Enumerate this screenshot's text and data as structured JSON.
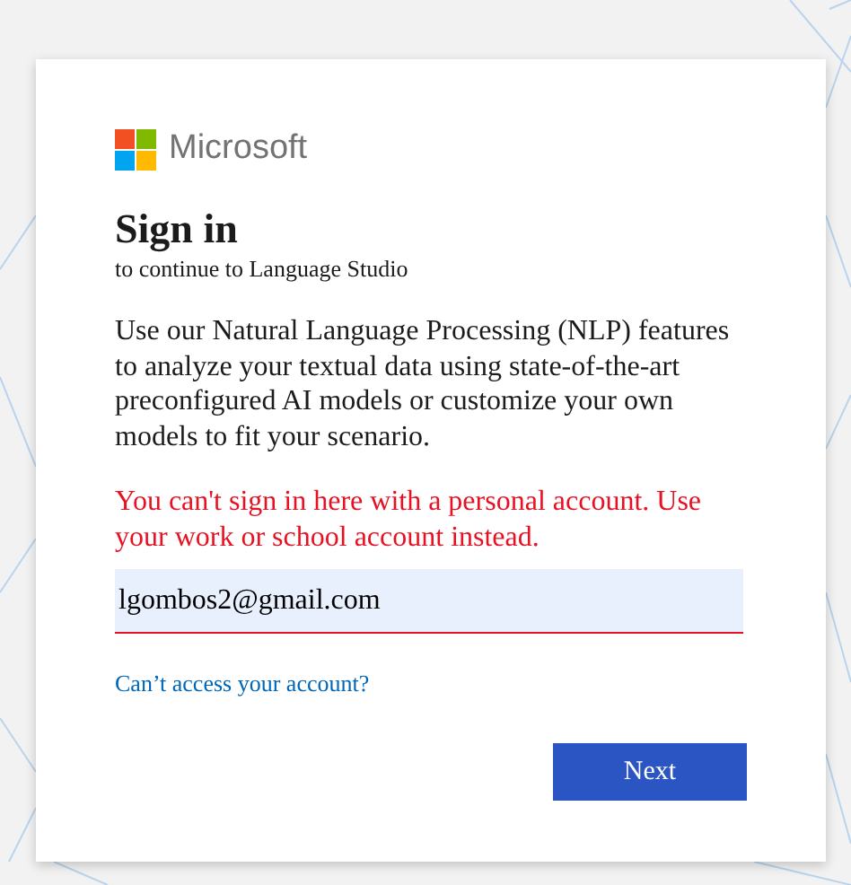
{
  "brand": {
    "name": "Microsoft"
  },
  "title": "Sign in",
  "subtitle": "to continue to Language Studio",
  "description": "Use our Natural Language Processing (NLP) features to analyze your textual data using state-of-the-art preconfigured AI models or customize your own models to fit your scenario.",
  "error": "You can't sign in here with a personal account. Use your work or school account instead.",
  "email_field": {
    "value": "lgombos2@gmail.com",
    "invalid": true
  },
  "help_link": "Can’t access your account?",
  "buttons": [
    {
      "label": "Next",
      "kind": "primary"
    }
  ]
}
